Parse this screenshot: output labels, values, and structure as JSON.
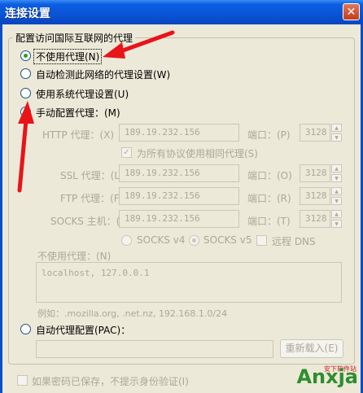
{
  "window": {
    "title": "连接设置",
    "close_glyph": "✕"
  },
  "group_title": "配置访问国际互联网的代理",
  "options": {
    "no_proxy": "不使用代理(N)",
    "auto_detect": "自动检测此网络的代理设置(W)",
    "system_proxy": "使用系统代理设置(U)",
    "manual_proxy": "手动配置代理：(M)",
    "auto_config": "自动代理配置(PAC)："
  },
  "manual": {
    "http_label": "HTTP 代理：(X)",
    "http_host": "189.19.232.156",
    "http_port_label": "端口：(P)",
    "http_port": "3128",
    "share_label": "为所有协议使用相同代理(S)",
    "ssl_label": "SSL 代理：(L)",
    "ssl_host": "189.19.232.156",
    "ssl_port_label": "端口：(O)",
    "ssl_port": "3128",
    "ftp_label": "FTP 代理：(F)",
    "ftp_host": "189.19.232.156",
    "ftp_port_label": "端口：(R)",
    "ftp_port": "3128",
    "socks_label": "SOCKS 主机：(C)",
    "socks_host": "189.19.232.156",
    "socks_port_label": "端口：(T)",
    "socks_port": "3128",
    "socks_v4": "SOCKS v4",
    "socks_v5": "SOCKS v5",
    "remote_dns": "远程 DNS"
  },
  "no_proxy_for": {
    "label": "不使用代理：(N)",
    "value": "localhost, 127.0.0.1",
    "example": "例如：.mozilla.org, .net.nz, 192.168.1.0/24"
  },
  "pac": {
    "url": "",
    "reload_button": "重新载入(E)"
  },
  "remember_password": "如果密码已保存，不提示身份验证(I)",
  "watermark": {
    "brand": "Anxja",
    "sub": "安下软件站"
  },
  "colors": {
    "titlebar": "#0a54d6",
    "dialog_bg": "#ece9d8",
    "annotation": "#e8141a",
    "radio_dot": "#21a121"
  }
}
